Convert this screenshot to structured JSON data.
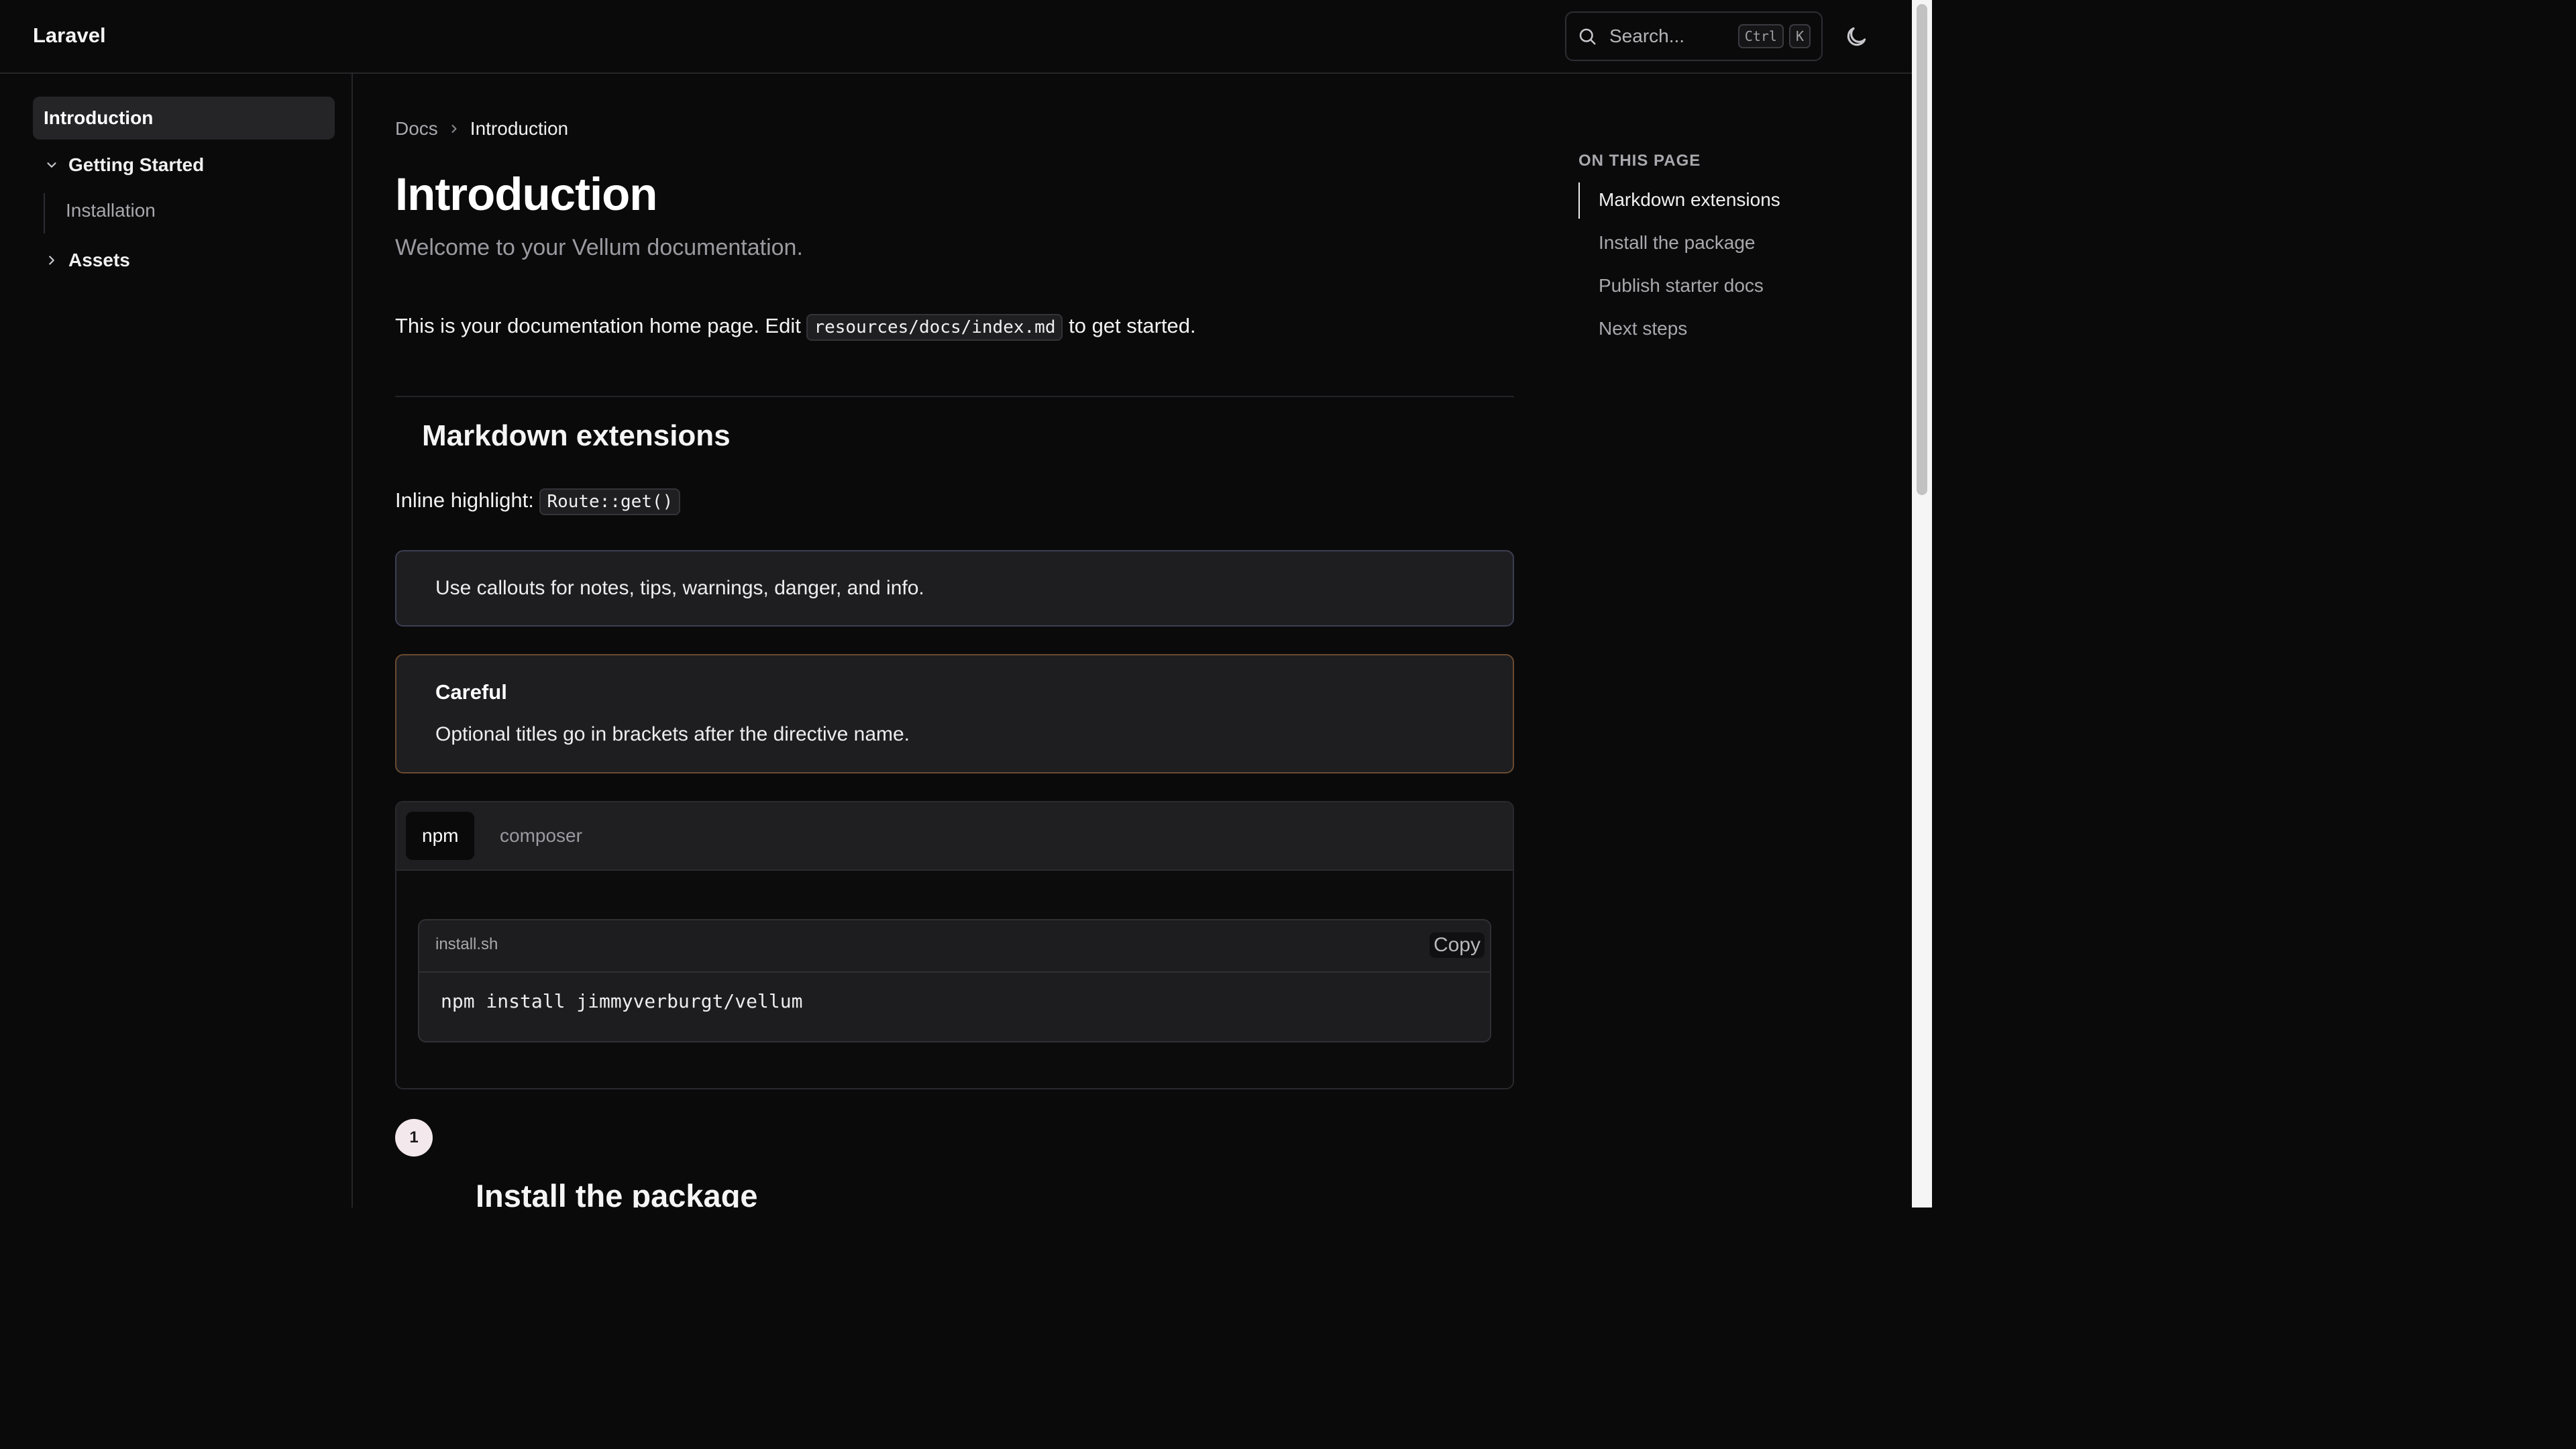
{
  "header": {
    "brand": "Laravel",
    "search_placeholder": "Search...",
    "shortcut_keys": [
      "Ctrl",
      "K"
    ],
    "theme_icon": "moon-icon"
  },
  "sidebar": {
    "items": [
      {
        "label": "Introduction",
        "active": true
      },
      {
        "label": "Getting Started",
        "expanded": true,
        "icon": "chevron-down-icon"
      },
      {
        "label": "Installation"
      },
      {
        "label": "Assets",
        "expanded": false,
        "icon": "chevron-right-icon"
      }
    ]
  },
  "breadcrumb": {
    "root": "Docs",
    "current": "Introduction"
  },
  "main": {
    "title": "Introduction",
    "lead": "Welcome to your Vellum documentation.",
    "intro_before": "This is your documentation home page. Edit ",
    "intro_code": "resources/docs/index.md",
    "intro_after": " to get started.",
    "section_heading": "Markdown extensions",
    "inline_label": "Inline highlight: ",
    "inline_code": "Route::get()",
    "callout_note": "Use callouts for notes, tips, warnings, danger, and info.",
    "callout_warning": {
      "title": "Careful",
      "body": "Optional titles go in brackets after the directive name."
    },
    "tabs": [
      {
        "label": "npm",
        "active": true
      },
      {
        "label": "composer",
        "active": false
      }
    ],
    "code_block": {
      "filename": "install.sh",
      "copy_label": "Copy",
      "code": "npm install jimmyverburgt/vellum"
    },
    "step": {
      "number": "1",
      "heading": "Install the package"
    }
  },
  "toc": {
    "title": "ON THIS PAGE",
    "items": [
      {
        "label": "Markdown extensions",
        "active": true
      },
      {
        "label": "Install the package"
      },
      {
        "label": "Publish starter docs"
      },
      {
        "label": "Next steps"
      }
    ]
  },
  "colors": {
    "background": "#0a0a0b",
    "note_border": "#3d3e52",
    "warning_border": "#6b4a2e",
    "step_badge": "#f3e8ec"
  }
}
